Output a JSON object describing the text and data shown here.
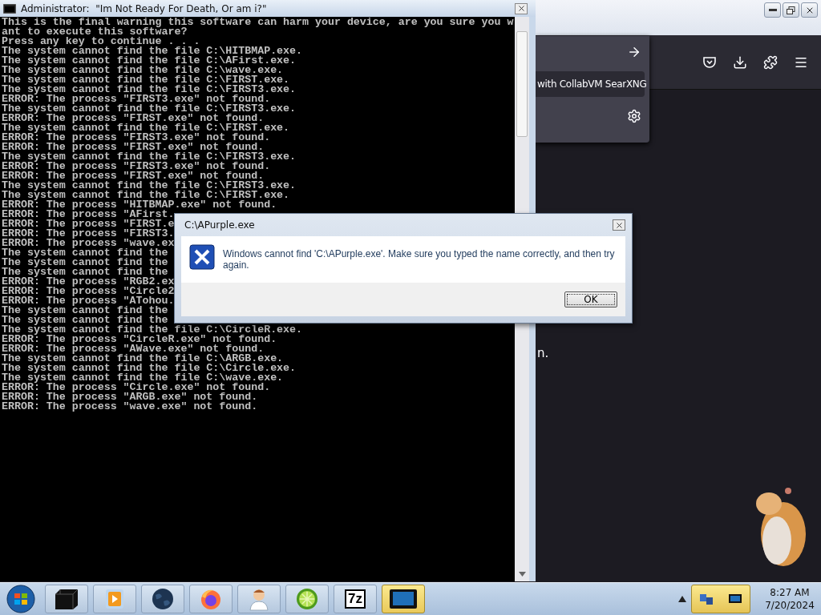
{
  "console": {
    "title": "Administrator:  \"Im Not Ready For Death, Or am i?\"",
    "lines": [
      "This is the final warning this software can harm your device, are you sure you w",
      "ant to execute this software?",
      "Press any key to continue . . .",
      "The system cannot find the file C:\\HITBMAP.exe.",
      "The system cannot find the file C:\\AFirst.exe.",
      "The system cannot find the file C:\\wave.exe.",
      "The system cannot find the file C:\\FIRST.exe.",
      "The system cannot find the file C:\\FIRST3.exe.",
      "ERROR: The process \"FIRST3.exe\" not found.",
      "The system cannot find the file C:\\FIRST3.exe.",
      "ERROR: The process \"FIRST.exe\" not found.",
      "The system cannot find the file C:\\FIRST.exe.",
      "ERROR: The process \"FIRST3.exe\" not found.",
      "ERROR: The process \"FIRST.exe\" not found.",
      "The system cannot find the file C:\\FIRST3.exe.",
      "ERROR: The process \"FIRST3.exe\" not found.",
      "ERROR: The process \"FIRST.exe\" not found.",
      "The system cannot find the file C:\\FIRST3.exe.",
      "The system cannot find the file C:\\FIRST.exe.",
      "ERROR: The process \"HITBMAP.exe\" not found.",
      "ERROR: The process \"AFirst.",
      "ERROR: The process \"FIRST.e",
      "ERROR: The process \"FIRST3.",
      "ERROR: The process \"wave.ex",
      "The system cannot find the",
      "The system cannot find the",
      "The system cannot find the",
      "ERROR: The process \"RGB2.ex",
      "ERROR: The process \"Circle2",
      "ERROR: The process \"ATohou.",
      "The system cannot find the",
      "The system cannot find the",
      "The system cannot find the file C:\\CircleR.exe.",
      "ERROR: The process \"CircleR.exe\" not found.",
      "ERROR: The process \"AWave.exe\" not found.",
      "The system cannot find the file C:\\ARGB.exe.",
      "The system cannot find the file C:\\Circle.exe.",
      "The system cannot find the file C:\\wave.exe.",
      "ERROR: The process \"Circle.exe\" not found.",
      "ERROR: The process \"ARGB.exe\" not found.",
      "ERROR: The process \"wave.exe\" not found."
    ]
  },
  "browser": {
    "menu_item": "with CollabVM SearXNG",
    "fragment": "n."
  },
  "dialog": {
    "title": "C:\\APurple.exe",
    "message": "Windows cannot find 'C:\\APurple.exe'. Make sure you typed the name correctly, and then try again.",
    "button": "OK"
  },
  "taskbar": {
    "items": [
      {
        "kind": "terminal",
        "selected": false
      },
      {
        "kind": "media",
        "selected": false
      },
      {
        "kind": "globe",
        "selected": false
      },
      {
        "kind": "firefox",
        "selected": false
      },
      {
        "kind": "person",
        "selected": false
      },
      {
        "kind": "lime",
        "selected": false
      },
      {
        "kind": "archiver",
        "label": "7z",
        "selected": false
      },
      {
        "kind": "monitor",
        "selected": true
      }
    ],
    "clock": {
      "time": "8:27 AM",
      "date": "7/20/2024"
    }
  }
}
